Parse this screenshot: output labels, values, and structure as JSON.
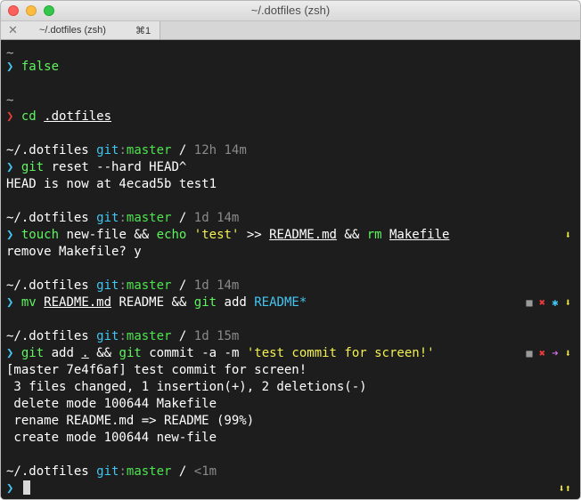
{
  "window": {
    "title": "~/.dotfiles (zsh)"
  },
  "tab": {
    "close_glyph": "✕",
    "title": "~/.dotfiles (zsh)",
    "shortcut": "⌘1"
  },
  "terminal": {
    "prompt_char": "❯",
    "tilde": "~",
    "l1_cmd": "false",
    "l2_cmd": "cd",
    "l2_arg": ".dotfiles",
    "path": "~/.dotfiles",
    "git_label": "git",
    "colon": ":",
    "branch": "master",
    "slash": "/",
    "time1": "12h 14m",
    "c1_cmd": "git",
    "c1_args": "reset --hard HEAD^",
    "out1": "HEAD is now at 4ecad5b test1",
    "time2": "1d 14m",
    "c2_touch": "touch",
    "c2_newfile": "new-file",
    "c2_and": "&&",
    "c2_echo": "echo",
    "c2_str": "'test'",
    "c2_redir": ">>",
    "c2_readme": "README.md",
    "c2_rm": "rm",
    "c2_makefile": "Makefile",
    "out2": "remove Makefile? y",
    "time3": "1d 14m",
    "c3_mv": "mv",
    "c3_readme": "README.md",
    "c3_dest": "README",
    "c3_git": "git",
    "c3_add": "add",
    "c3_target": "README*",
    "time4": "1d 15m",
    "c4_git": "git",
    "c4_add": "add",
    "c4_dot": ".",
    "c4_git2": "git",
    "c4_commit": "commit -a -m",
    "c4_msg": "'test commit for screen!'",
    "out4": [
      "[master 7e4f6af] test commit for screen!",
      " 3 files changed, 1 insertion(+), 2 deletions(-)",
      " delete mode 100644 Makefile",
      " rename README.md => README (99%)",
      " create mode 100644 new-file"
    ],
    "time5": "<1m"
  },
  "status": {
    "arrow_down": "⬇",
    "arrow_up": "⬆",
    "arrow_right": "➜",
    "square": "■",
    "cross": "✖",
    "star": "✱"
  }
}
